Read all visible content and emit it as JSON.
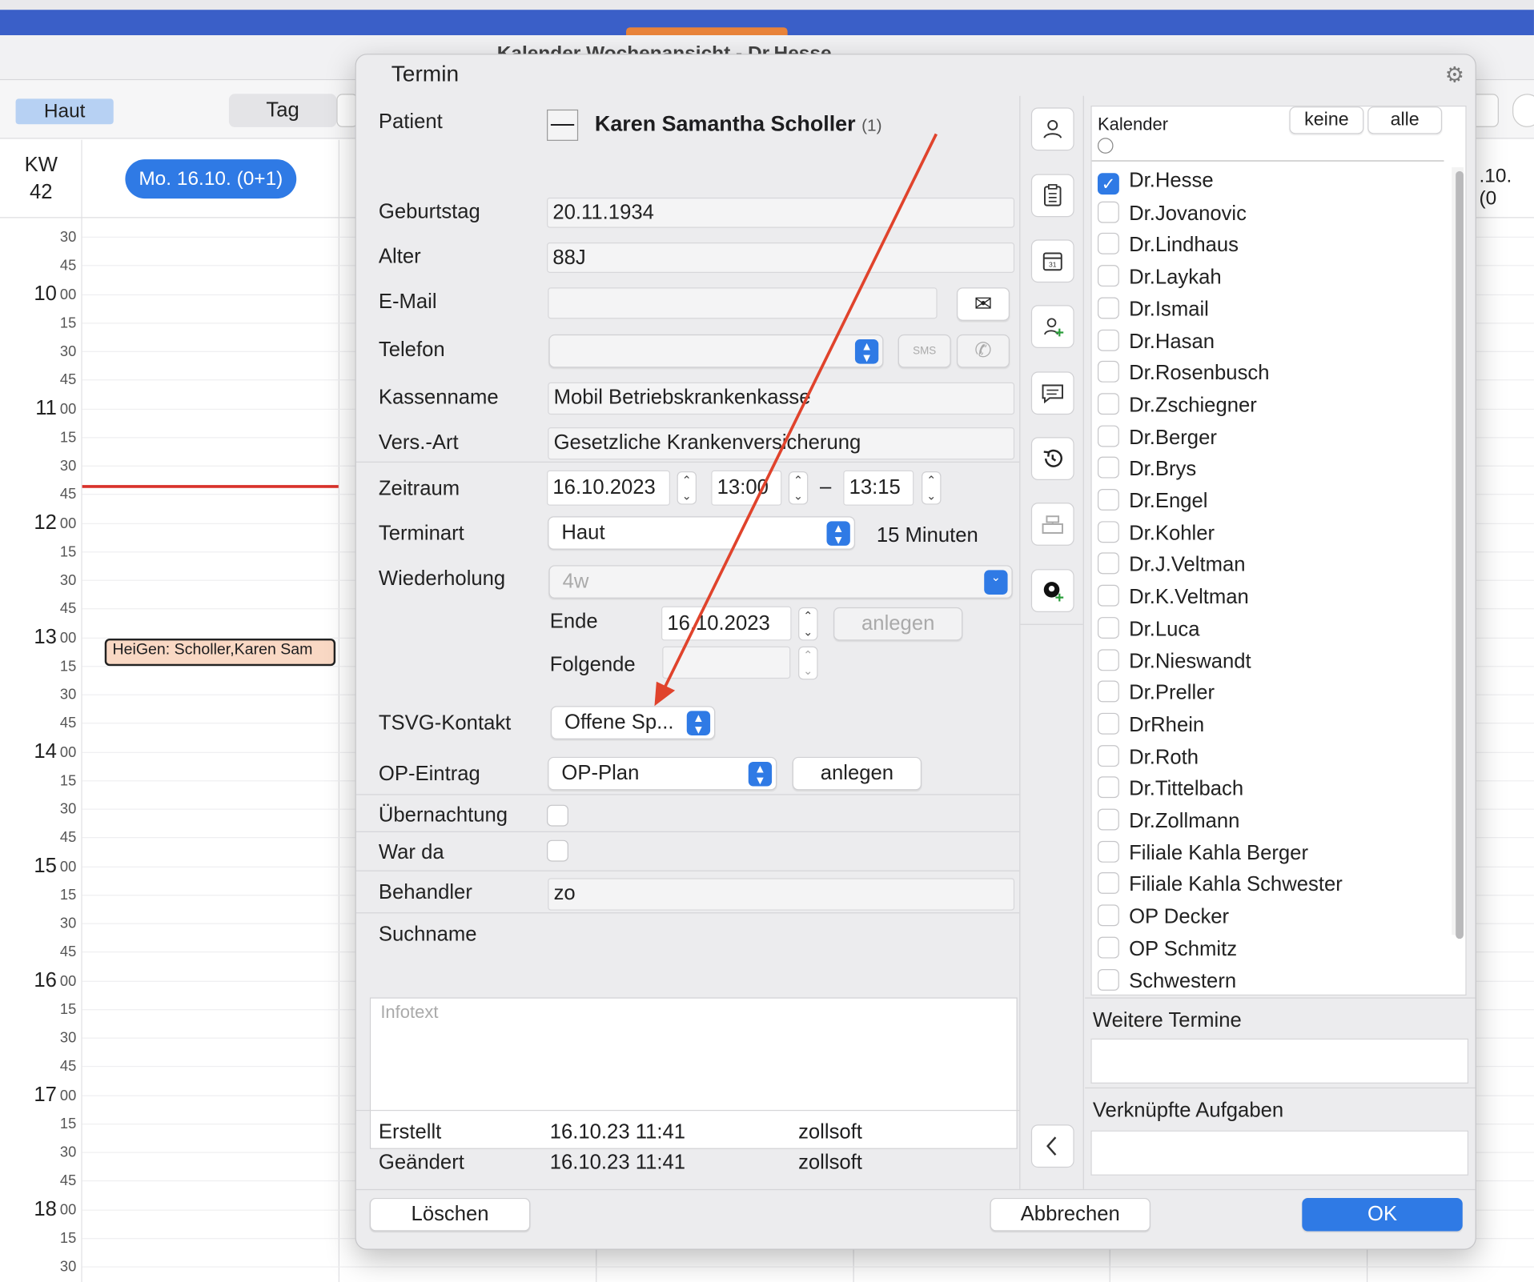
{
  "window": {
    "title": "Kalender Wochenansicht - Dr.Hesse"
  },
  "toolbar": {
    "haut_label": "Haut",
    "tag_label": "Tag"
  },
  "calendar": {
    "kw_label": "KW",
    "kw_number": "42",
    "day_pill": "Mo. 16.10. (0+1)",
    "next_day_partial": ".10. (0",
    "time_rows": [
      {
        "h": "",
        "m": "30"
      },
      {
        "h": "",
        "m": "45"
      },
      {
        "h": "10",
        "m": "00"
      },
      {
        "h": "",
        "m": "15"
      },
      {
        "h": "",
        "m": "30"
      },
      {
        "h": "",
        "m": "45"
      },
      {
        "h": "11",
        "m": "00"
      },
      {
        "h": "",
        "m": "15"
      },
      {
        "h": "",
        "m": "30"
      },
      {
        "h": "",
        "m": "45"
      },
      {
        "h": "12",
        "m": "00"
      },
      {
        "h": "",
        "m": "15"
      },
      {
        "h": "",
        "m": "30"
      },
      {
        "h": "",
        "m": "45"
      },
      {
        "h": "13",
        "m": "00"
      },
      {
        "h": "",
        "m": "15"
      },
      {
        "h": "",
        "m": "30"
      },
      {
        "h": "",
        "m": "45"
      },
      {
        "h": "14",
        "m": "00"
      },
      {
        "h": "",
        "m": "15"
      },
      {
        "h": "",
        "m": "30"
      },
      {
        "h": "",
        "m": "45"
      },
      {
        "h": "15",
        "m": "00"
      },
      {
        "h": "",
        "m": "15"
      },
      {
        "h": "",
        "m": "30"
      },
      {
        "h": "",
        "m": "45"
      },
      {
        "h": "16",
        "m": "00"
      },
      {
        "h": "",
        "m": "15"
      },
      {
        "h": "",
        "m": "30"
      },
      {
        "h": "",
        "m": "45"
      },
      {
        "h": "17",
        "m": "00"
      },
      {
        "h": "",
        "m": "15"
      },
      {
        "h": "",
        "m": "30"
      },
      {
        "h": "",
        "m": "45"
      },
      {
        "h": "18",
        "m": "00"
      },
      {
        "h": "",
        "m": "15"
      },
      {
        "h": "",
        "m": "30"
      }
    ],
    "event_text": "HeiGen: Scholler,Karen Sam"
  },
  "dialog": {
    "title": "Termin",
    "patient_label": "Patient",
    "patient_name": "Karen Samantha Scholler",
    "patient_count": "(1)",
    "geburtstag_label": "Geburtstag",
    "geburtstag": "20.11.1934",
    "alter_label": "Alter",
    "alter": "88J",
    "email_label": "E-Mail",
    "email": "",
    "telefon_label": "Telefon",
    "sms_label": "SMS",
    "kassenname_label": "Kassenname",
    "kassenname": "Mobil Betriebskrankenkasse",
    "versart_label": "Vers.-Art",
    "versart": "Gesetzliche Krankenversicherung",
    "zeitraum_label": "Zeitraum",
    "date": "16.10.2023",
    "start_time": "13:00",
    "dash": "–",
    "end_time": "13:15",
    "terminart_label": "Terminart",
    "terminart": "Haut",
    "duration": "15 Minuten",
    "wiederholung_label": "Wiederholung",
    "wiederholung": "4w",
    "ende_label": "Ende",
    "ende": "16.10.2023",
    "anlegen_disabled": "anlegen",
    "folgende_label": "Folgende",
    "tsvg_label": "TSVG-Kontakt",
    "tsvg": "Offene Sp...",
    "op_label": "OP-Eintrag",
    "op": "OP-Plan",
    "op_anlegen": "anlegen",
    "uebernachtung_label": "Übernachtung",
    "warda_label": "War da",
    "behandler_label": "Behandler",
    "behandler": "zo",
    "suchname_label": "Suchname",
    "infotext_placeholder": "Infotext",
    "erstellt_label": "Erstellt",
    "erstellt_date": "16.10.23 11:41",
    "erstellt_user": "zollsoft",
    "geaendert_label": "Geändert",
    "geaendert_date": "16.10.23 11:41",
    "geaendert_user": "zollsoft"
  },
  "right": {
    "kalender_label": "Kalender",
    "keine": "keine",
    "alle": "alle",
    "calendars": [
      {
        "name": "Dr.Hesse",
        "checked": true
      },
      {
        "name": "Dr.Jovanovic",
        "checked": false
      },
      {
        "name": "Dr.Lindhaus",
        "checked": false
      },
      {
        "name": "Dr.Laykah",
        "checked": false
      },
      {
        "name": "Dr.Ismail",
        "checked": false
      },
      {
        "name": "Dr.Hasan",
        "checked": false
      },
      {
        "name": "Dr.Rosenbusch",
        "checked": false
      },
      {
        "name": "Dr.Zschiegner",
        "checked": false
      },
      {
        "name": "Dr.Berger",
        "checked": false
      },
      {
        "name": "Dr.Brys",
        "checked": false
      },
      {
        "name": "Dr.Engel",
        "checked": false
      },
      {
        "name": "Dr.Kohler",
        "checked": false
      },
      {
        "name": "Dr.J.Veltman",
        "checked": false
      },
      {
        "name": "Dr.K.Veltman",
        "checked": false
      },
      {
        "name": "Dr.Luca",
        "checked": false
      },
      {
        "name": "Dr.Nieswandt",
        "checked": false
      },
      {
        "name": "Dr.Preller",
        "checked": false
      },
      {
        "name": "DrRhein",
        "checked": false
      },
      {
        "name": "Dr.Roth",
        "checked": false
      },
      {
        "name": "Dr.Tittelbach",
        "checked": false
      },
      {
        "name": "Dr.Zollmann",
        "checked": false
      },
      {
        "name": "Filiale Kahla Berger",
        "checked": false
      },
      {
        "name": "Filiale Kahla Schwester",
        "checked": false
      },
      {
        "name": "OP Decker",
        "checked": false
      },
      {
        "name": "OP Schmitz",
        "checked": false
      },
      {
        "name": "Schwestern",
        "checked": false
      }
    ],
    "weitere_label": "Weitere Termine",
    "aufgaben_label": "Verknüpfte Aufgaben"
  },
  "footer": {
    "loeschen": "Löschen",
    "abbrechen": "Abbrechen",
    "ok": "OK"
  },
  "colors": {
    "accent": "#2f7ae5",
    "title_bar": "#3a5fc8",
    "now_line": "#d9322b",
    "event_bg": "#f9d8c4",
    "annotation_arrow": "#e0432c"
  },
  "icons": [
    "person-icon",
    "clipboard-icon",
    "calendar-icon",
    "add-person-icon",
    "message-icon",
    "history-icon",
    "cash-register-icon",
    "add-location-icon",
    "chevron-left-icon",
    "gear-icon",
    "mail-icon",
    "phone-icon",
    "sms-icon"
  ]
}
